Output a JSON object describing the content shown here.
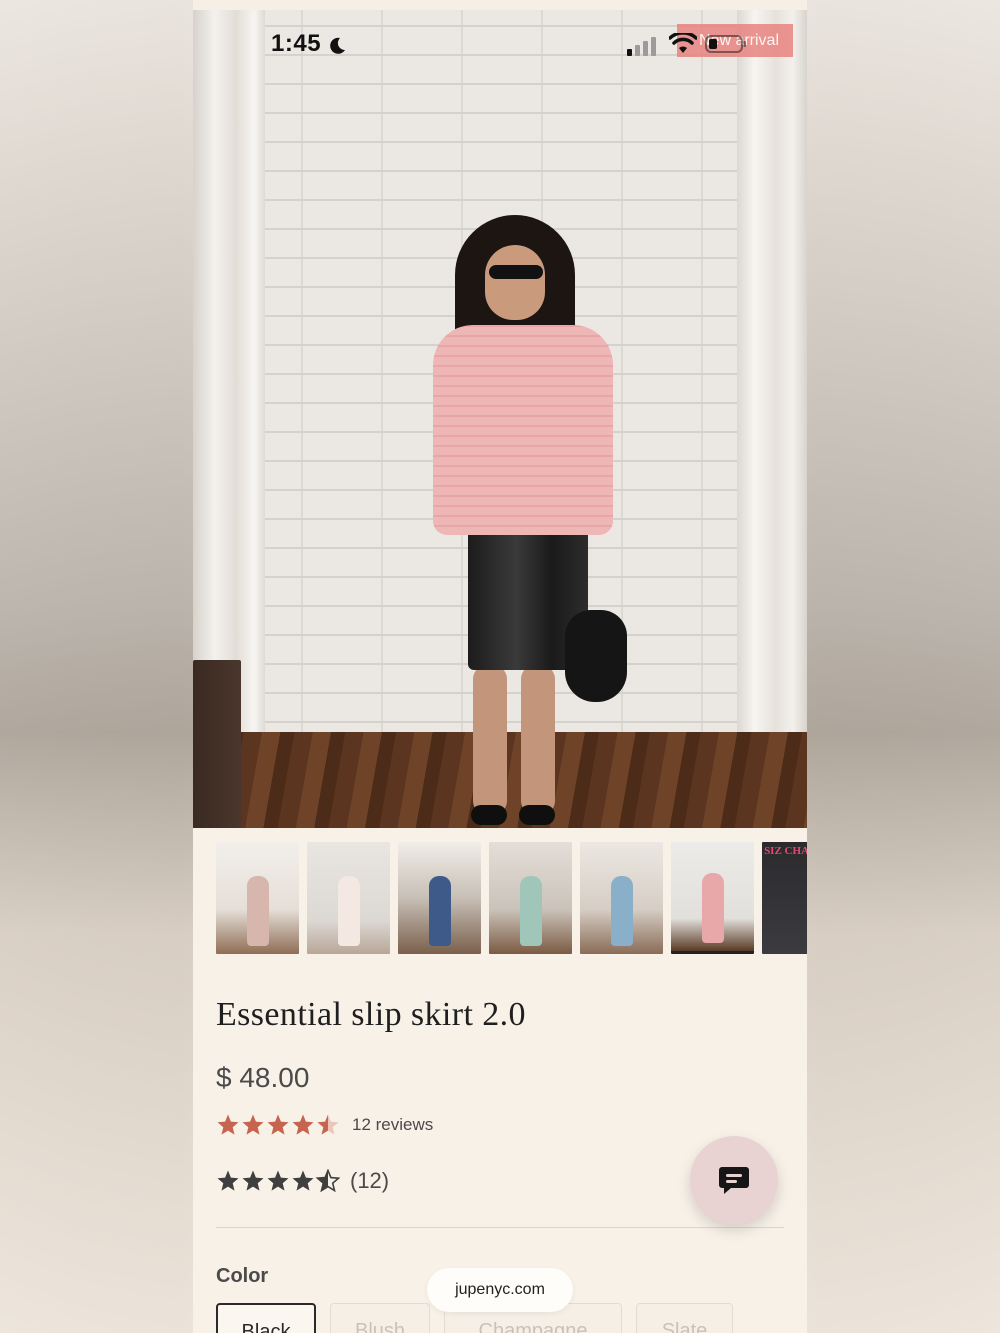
{
  "status_bar": {
    "time": "1:45"
  },
  "hero": {
    "badge": "New arrival"
  },
  "gallery": {
    "thumb_count": 7,
    "active_index": 5,
    "size_chart_text": "SIZ CHA"
  },
  "product": {
    "title": "Essential slip skirt 2.0",
    "price": "$ 48.00",
    "rating": 4.5,
    "reviews_label": "12 reviews",
    "reviews_count": "(12)"
  },
  "options": {
    "color_label": "Color",
    "colors": [
      "Black",
      "Blush",
      "Champagne",
      "Slate"
    ],
    "selected": "Black"
  },
  "browser": {
    "url": "jupenyc.com"
  },
  "colors": {
    "page_bg": "#f8f1e8",
    "star_accent": "#c7644f",
    "star_dark": "#3f3f3f",
    "badge_bg": "#e88480",
    "chat_bg": "#e9d3d2"
  },
  "icons": {
    "moon": "moon-icon",
    "signal": "signal-icon",
    "wifi": "wifi-icon",
    "battery": "battery-icon",
    "chat": "chat-icon",
    "star": "star-icon"
  }
}
